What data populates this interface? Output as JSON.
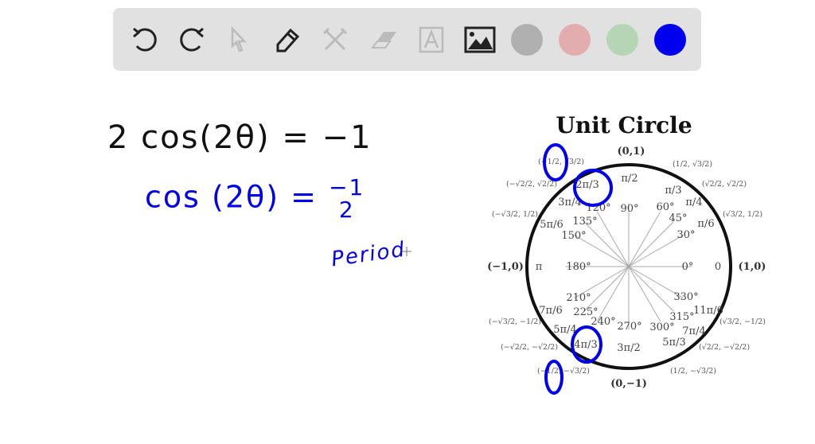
{
  "toolbar": {
    "tools": [
      "undo-icon",
      "redo-icon",
      "pointer-icon",
      "pencil-icon",
      "tools-icon",
      "eraser-icon",
      "text-icon",
      "image-icon"
    ],
    "colors": [
      "#b0b0b0",
      "#e3adb0",
      "#b5d5b5",
      "#0000ee"
    ],
    "selected_color": "#0000ee"
  },
  "handwriting": {
    "line1": "2 cos(2θ) = −1",
    "line2_left": "cos (2θ) = ",
    "line2_num": "−1",
    "line2_den": "2",
    "note": "Period"
  },
  "unit_circle": {
    "title": "Unit Circle",
    "axis_points": {
      "top": "(0,1)",
      "bottom": "(0,−1)",
      "left": "(−1,0)",
      "right": "(1,0)"
    },
    "degrees": [
      "0°",
      "30°",
      "45°",
      "60°",
      "90°",
      "120°",
      "135°",
      "150°",
      "180°",
      "210°",
      "225°",
      "240°",
      "270°",
      "300°",
      "315°",
      "330°"
    ],
    "radians": [
      "0",
      "π/6",
      "π/4",
      "π/3",
      "π/2",
      "2π/3",
      "3π/4",
      "5π/6",
      "π",
      "7π/6",
      "5π/4",
      "4π/3",
      "3π/2",
      "5π/3",
      "7π/4",
      "11π/6"
    ],
    "coordinates": [
      "(√3/2, 1/2)",
      "(√2/2, √2/2)",
      "(1/2, √3/2)",
      "(−1/2, √3/2)",
      "(−√2/2, √2/2)",
      "(−√3/2, 1/2)",
      "(−√3/2, −1/2)",
      "(−√2/2, −√2/2)",
      "(−1/2, −√3/2)",
      "(1/2, −√3/2)",
      "(√2/2, −√2/2)",
      "(√3/2, −1/2)"
    ]
  },
  "annotation_color": "#0000ee"
}
